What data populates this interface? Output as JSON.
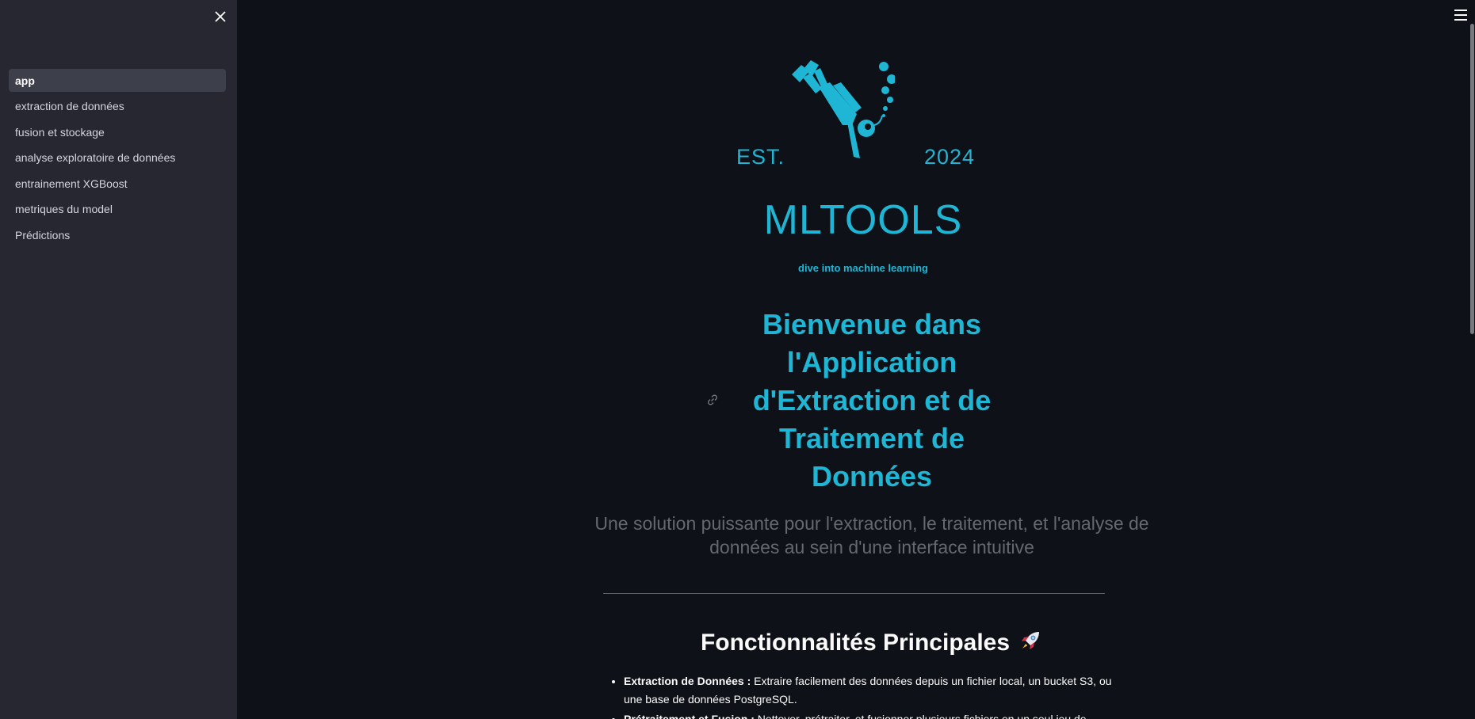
{
  "sidebar": {
    "close_icon": "close-icon",
    "items": [
      {
        "label": "app",
        "active": true
      },
      {
        "label": "extraction de données",
        "active": false
      },
      {
        "label": "fusion et stockage",
        "active": false
      },
      {
        "label": "analyse exploratoire de données",
        "active": false
      },
      {
        "label": "entrainement XGBoost",
        "active": false
      },
      {
        "label": "metriques du model",
        "active": false
      },
      {
        "label": "Prédictions",
        "active": false
      }
    ]
  },
  "header": {
    "menu_icon": "hamburger-menu-icon"
  },
  "logo": {
    "est": "EST.",
    "year": "2024",
    "name": "MLTOOLS",
    "tagline": "dive into machine learning",
    "icon": "scuba-diver-icon",
    "color": "#1fb6d5"
  },
  "hero": {
    "title": "Bienvenue dans l'Application d'Extraction et de Traitement de Données",
    "subtitle": "Une solution puissante pour l'extraction, le traitement, et l'analyse de données au sein d'une interface intuitive",
    "anchor_icon": "link-icon"
  },
  "features": {
    "title": "Fonctionnalités Principales",
    "title_icon": "rocket-icon",
    "items": [
      {
        "name": "Extraction de Données :",
        "text": " Extraire facilement des données depuis un fichier local, un bucket S3, ou une base de données PostgreSQL."
      },
      {
        "name": "Prétraitement et Fusion :",
        "text": " Nettoyer, prétraiter, et fusionner plusieurs fichiers en un seul jeu de données."
      }
    ]
  },
  "colors": {
    "background": "#0e1117",
    "sidebar": "#262730",
    "accent": "#1fb6d5",
    "text": "#fafafa",
    "muted": "#666870"
  }
}
